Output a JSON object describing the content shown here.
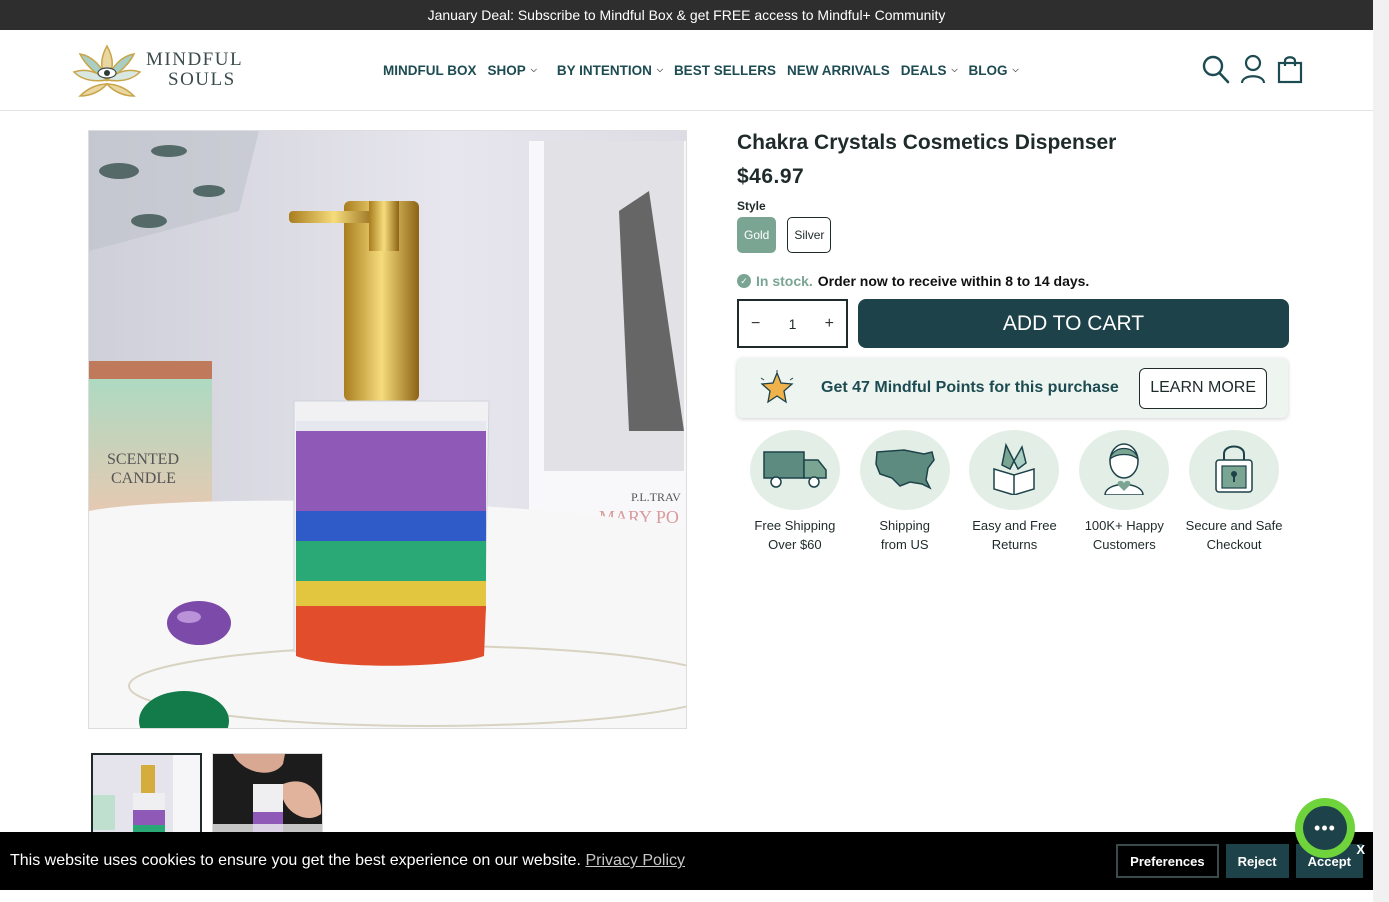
{
  "announcement": "January Deal: Subscribe to Mindful Box & get FREE access to Mindful+ Community",
  "logo": {
    "line1": "MINDFUL",
    "line2": "SOULS"
  },
  "nav": [
    {
      "label": "MINDFUL BOX",
      "has_menu": false
    },
    {
      "label": "SHOP",
      "has_menu": true
    },
    {
      "label": "BY INTENTION",
      "has_menu": true
    },
    {
      "label": "BEST SELLERS",
      "has_menu": false
    },
    {
      "label": "NEW ARRIVALS",
      "has_menu": false
    },
    {
      "label": "DEALS",
      "has_menu": true
    },
    {
      "label": "BLOG",
      "has_menu": true
    }
  ],
  "header_icons": [
    "search-icon",
    "account-icon",
    "cart-icon"
  ],
  "product": {
    "title": "Chakra Crystals Cosmetics Dispenser",
    "price": "$46.97",
    "style_label": "Style",
    "styles": [
      {
        "label": "Gold",
        "selected": true
      },
      {
        "label": "Silver",
        "selected": false
      }
    ],
    "stock_status": "In stock.",
    "delivery_note": "Order now to receive within 8 to 14 days.",
    "quantity": "1",
    "add_to_cart": "ADD TO CART",
    "image_text": {
      "candle_line1": "SCENTED",
      "candle_line2": "CANDLE",
      "book_author": "P.L.TRAV",
      "book_title": "MARY PO"
    }
  },
  "points": {
    "text": "Get 47 Mindful Points for this purchase",
    "button": "LEARN MORE"
  },
  "features": [
    {
      "icon": "truck-icon",
      "line1": "Free Shipping",
      "line2": "Over $60"
    },
    {
      "icon": "usa-map-icon",
      "line1": "Shipping",
      "line2": "from US"
    },
    {
      "icon": "crystal-box-icon",
      "line1": "Easy and Free",
      "line2": "Returns"
    },
    {
      "icon": "happy-customer-icon",
      "line1": "100K+ Happy",
      "line2": "Customers"
    },
    {
      "icon": "secure-lock-icon",
      "line1": "Secure and Safe",
      "line2": "Checkout"
    }
  ],
  "cookie": {
    "message": "This website uses cookies to ensure you get the best experience on our website.",
    "link": "Privacy Policy",
    "preferences": "Preferences",
    "reject": "Reject",
    "accept": "Accept",
    "close": "X"
  },
  "colors": {
    "accent": "#1d4249",
    "sage": "#7ba593",
    "chat": "#6fd33c"
  }
}
